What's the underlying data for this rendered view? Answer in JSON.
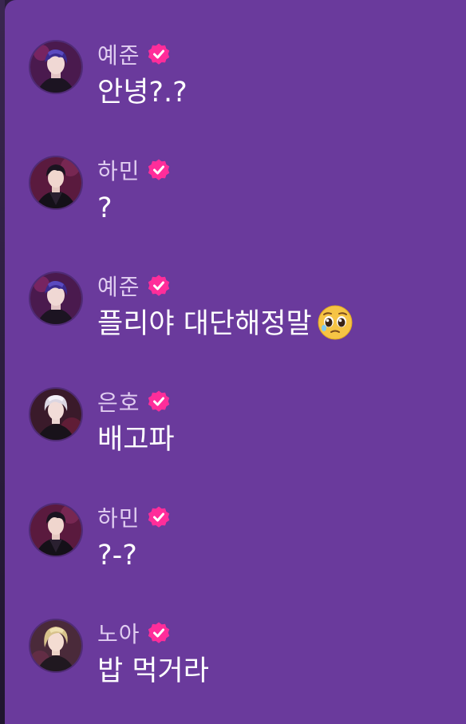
{
  "colors": {
    "panel_bg": "#6a3a9c",
    "name_text": "#e0cdf0",
    "message_text": "#ffffff",
    "verified_badge": "#ff2d9a"
  },
  "messages": [
    {
      "avatar": "yejun-avatar",
      "name": "예준",
      "verified_icon": "verified-badge-icon",
      "text": "안녕?.?"
    },
    {
      "avatar": "hamin-avatar",
      "name": "하민",
      "verified_icon": "verified-badge-icon",
      "text": "?"
    },
    {
      "avatar": "yejun-avatar",
      "name": "예준",
      "verified_icon": "verified-badge-icon",
      "text": "플리야 대단해정말",
      "emoji": "pleading-face-emoji"
    },
    {
      "avatar": "eunho-avatar",
      "name": "은호",
      "verified_icon": "verified-badge-icon",
      "text": "배고파"
    },
    {
      "avatar": "hamin-avatar",
      "name": "하민",
      "verified_icon": "verified-badge-icon",
      "text": "?-?"
    },
    {
      "avatar": "noah-avatar",
      "name": "노아",
      "verified_icon": "verified-badge-icon",
      "text": "밥 먹거라"
    }
  ]
}
